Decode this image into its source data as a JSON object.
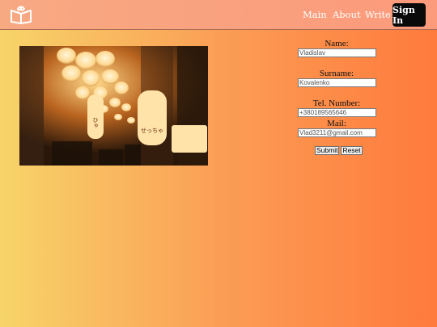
{
  "header": {
    "logo_icon": "open-book-icon",
    "nav": {
      "main": "Main",
      "about": "About",
      "write": "Write"
    },
    "sign_in": "Sign In"
  },
  "photo": {
    "lantern_text_1": "ひゃ",
    "lantern_text_2": "せっちゃ"
  },
  "form": {
    "name_label": "Name:",
    "name_value": "Vladislav",
    "surname_label": "Surname:",
    "surname_value": "Kovalenko",
    "tel_label": "Tel. Number:",
    "tel_value": "+380189565646",
    "mail_label": "Mail:",
    "mail_value": "Vlad3211@gmail.com",
    "submit": "Submit",
    "reset": "Reset"
  },
  "colors": {
    "header": "#fc9a7c",
    "signin_bg": "#0a0a0a",
    "page_gradient_start": "#f7d46a",
    "page_gradient_end": "#ff7a3c"
  }
}
